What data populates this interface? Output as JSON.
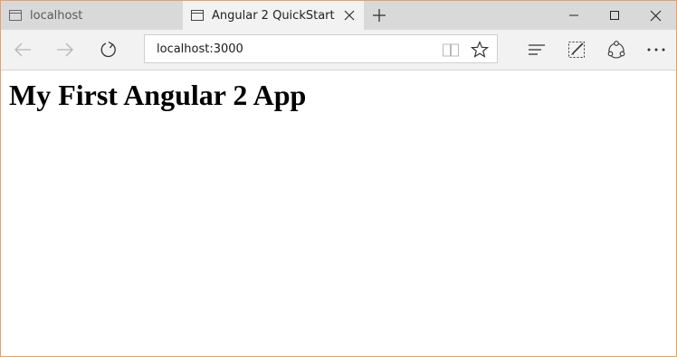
{
  "tabs": [
    {
      "title": "localhost",
      "active": false
    },
    {
      "title": "Angular 2 QuickStart",
      "active": true
    }
  ],
  "address_bar": {
    "url": "localhost:3000"
  },
  "page": {
    "heading": "My First Angular 2 App"
  },
  "icons": {
    "tab_page": "page-icon",
    "tab_close": "close-icon",
    "new_tab": "plus-icon",
    "minimize": "minimize-icon",
    "maximize": "maximize-icon",
    "window_close": "close-icon",
    "back": "back-arrow-icon",
    "forward": "forward-arrow-icon",
    "refresh": "refresh-icon",
    "reading_view": "reading-view-icon",
    "favorite": "star-icon",
    "hub": "hub-icon",
    "web_note": "web-note-icon",
    "share": "share-icon",
    "more": "more-icon"
  },
  "colors": {
    "window_border": "#e3a267",
    "tabbar_bg": "#d9d9d9",
    "active_tab_bg": "#f2f2f2",
    "toolbar_bg": "#f2f2f2"
  }
}
